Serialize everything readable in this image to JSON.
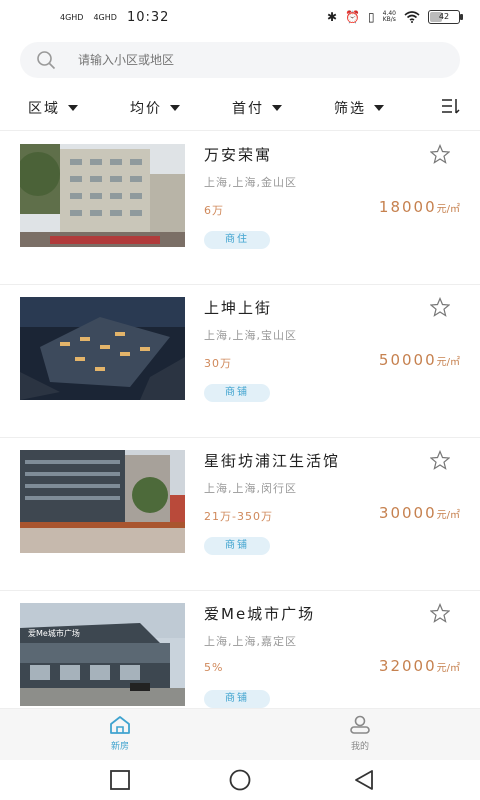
{
  "status_bar": {
    "signal_1": "4GHD",
    "signal_2": "4GHD",
    "time": "10:32",
    "net_speed_value": "4.40",
    "net_speed_unit": "KB/s",
    "battery": "42"
  },
  "search": {
    "placeholder": "请输入小区或地区"
  },
  "filters": [
    "区域",
    "均价",
    "首付",
    "筛选"
  ],
  "listings": [
    {
      "name": "万安荣寓",
      "location": "上海,上海,金山区",
      "total": "6万",
      "price": "18000",
      "unit": "元/㎡",
      "tag": "商住"
    },
    {
      "name": "上坤上街",
      "location": "上海,上海,宝山区",
      "total": "30万",
      "price": "50000",
      "unit": "元/㎡",
      "tag": "商铺"
    },
    {
      "name": "星街坊浦江生活馆",
      "location": "上海,上海,闵行区",
      "total": "21万-350万",
      "price": "30000",
      "unit": "元/㎡",
      "tag": "商铺"
    },
    {
      "name": "爱Me城市广场",
      "location": "上海,上海,嘉定区",
      "total": "5%",
      "price": "32000",
      "unit": "元/㎡",
      "tag": "商铺",
      "sign_text": "爱Me城市广场"
    }
  ],
  "tabbar": {
    "home": "新房",
    "mine": "我的"
  },
  "colors": {
    "price": "#c6814f",
    "tag_bg": "#e2f0f8",
    "tag_text": "#3fa3cf",
    "active_tab": "#3fa3cf"
  },
  "icons": [
    "search-icon",
    "caret-down-icon",
    "menu-icon",
    "star-icon",
    "home-icon",
    "person-icon",
    "square-icon",
    "circle-icon",
    "triangle-back-icon"
  ]
}
